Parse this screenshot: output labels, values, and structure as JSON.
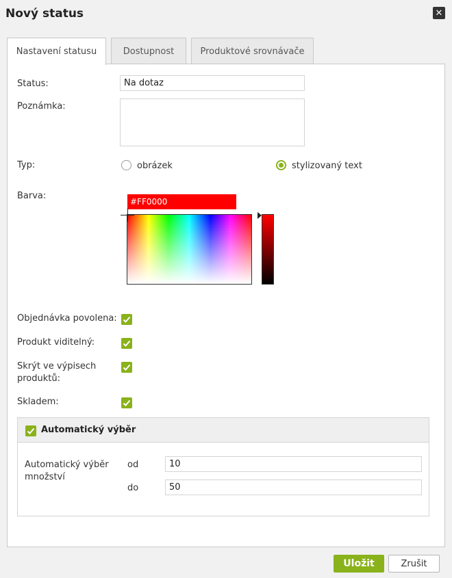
{
  "dialog": {
    "title": "Nový status",
    "close_icon": "close-icon"
  },
  "tabs": [
    {
      "label": "Nastavení statusu",
      "active": true
    },
    {
      "label": "Dostupnost",
      "active": false
    },
    {
      "label": "Produktové srovnávače",
      "active": false
    }
  ],
  "form": {
    "status": {
      "label": "Status:",
      "value": "Na dotaz"
    },
    "note": {
      "label": "Poznámka:",
      "value": ""
    },
    "type": {
      "label": "Typ:",
      "options": [
        {
          "label": "obrázek",
          "checked": false
        },
        {
          "label": "stylizovaný text",
          "checked": true
        }
      ]
    },
    "color": {
      "label": "Barva:",
      "hex": "#FF0000"
    },
    "order_allowed": {
      "label": "Objednávka povolena:",
      "checked": true
    },
    "product_visible": {
      "label": "Produkt viditelný:",
      "checked": true
    },
    "hide_in_listings": {
      "label": "Skrýt ve výpisech produktů:",
      "checked": true
    },
    "in_stock": {
      "label": "Skladem:",
      "checked": true
    }
  },
  "auto_selection": {
    "title": "Automatický výběr",
    "checked": true,
    "quantity_label": "Automatický výběr množství",
    "from_label": "od",
    "from_value": "10",
    "to_label": "do",
    "to_value": "50"
  },
  "footer": {
    "save_label": "Uložit",
    "cancel_label": "Zrušit"
  },
  "colors": {
    "accent": "#8ab21a",
    "picker_red": "#FF0000"
  }
}
